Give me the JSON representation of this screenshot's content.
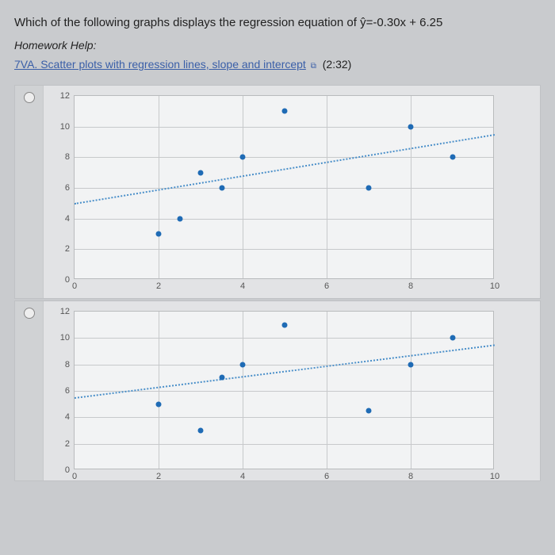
{
  "question": "Which of the following graphs displays the regression equation of ŷ=-0.30x + 6.25",
  "help_label": "Homework Help:",
  "help_link_text": "7VA. Scatter plots with regression lines, slope and intercept",
  "help_duration": "(2:32)",
  "chart_data": [
    {
      "type": "scatter",
      "xlabel": "",
      "ylabel": "",
      "xlim": [
        0,
        10
      ],
      "ylim": [
        0,
        12
      ],
      "x_ticks": [
        0,
        2,
        4,
        6,
        8,
        10
      ],
      "y_ticks": [
        0,
        2,
        4,
        6,
        8,
        10,
        12
      ],
      "points": [
        {
          "x": 2,
          "y": 3
        },
        {
          "x": 2.5,
          "y": 4
        },
        {
          "x": 3,
          "y": 7
        },
        {
          "x": 3.5,
          "y": 6
        },
        {
          "x": 4,
          "y": 8
        },
        {
          "x": 5,
          "y": 11
        },
        {
          "x": 7,
          "y": 6
        },
        {
          "x": 8,
          "y": 10
        },
        {
          "x": 9,
          "y": 8
        }
      ],
      "regression": {
        "slope": 0.45,
        "intercept": 5.0
      }
    },
    {
      "type": "scatter",
      "xlabel": "",
      "ylabel": "",
      "xlim": [
        0,
        10
      ],
      "ylim": [
        0,
        12
      ],
      "x_ticks": [
        0,
        2,
        4,
        6,
        8,
        10
      ],
      "y_ticks": [
        0,
        2,
        4,
        6,
        8,
        10,
        12
      ],
      "points": [
        {
          "x": 2,
          "y": 5
        },
        {
          "x": 3,
          "y": 3
        },
        {
          "x": 3.5,
          "y": 7
        },
        {
          "x": 4,
          "y": 8
        },
        {
          "x": 5,
          "y": 11
        },
        {
          "x": 7,
          "y": 4.5
        },
        {
          "x": 8,
          "y": 8
        },
        {
          "x": 9,
          "y": 10
        }
      ],
      "regression": {
        "slope": 0.4,
        "intercept": 5.5
      }
    }
  ]
}
